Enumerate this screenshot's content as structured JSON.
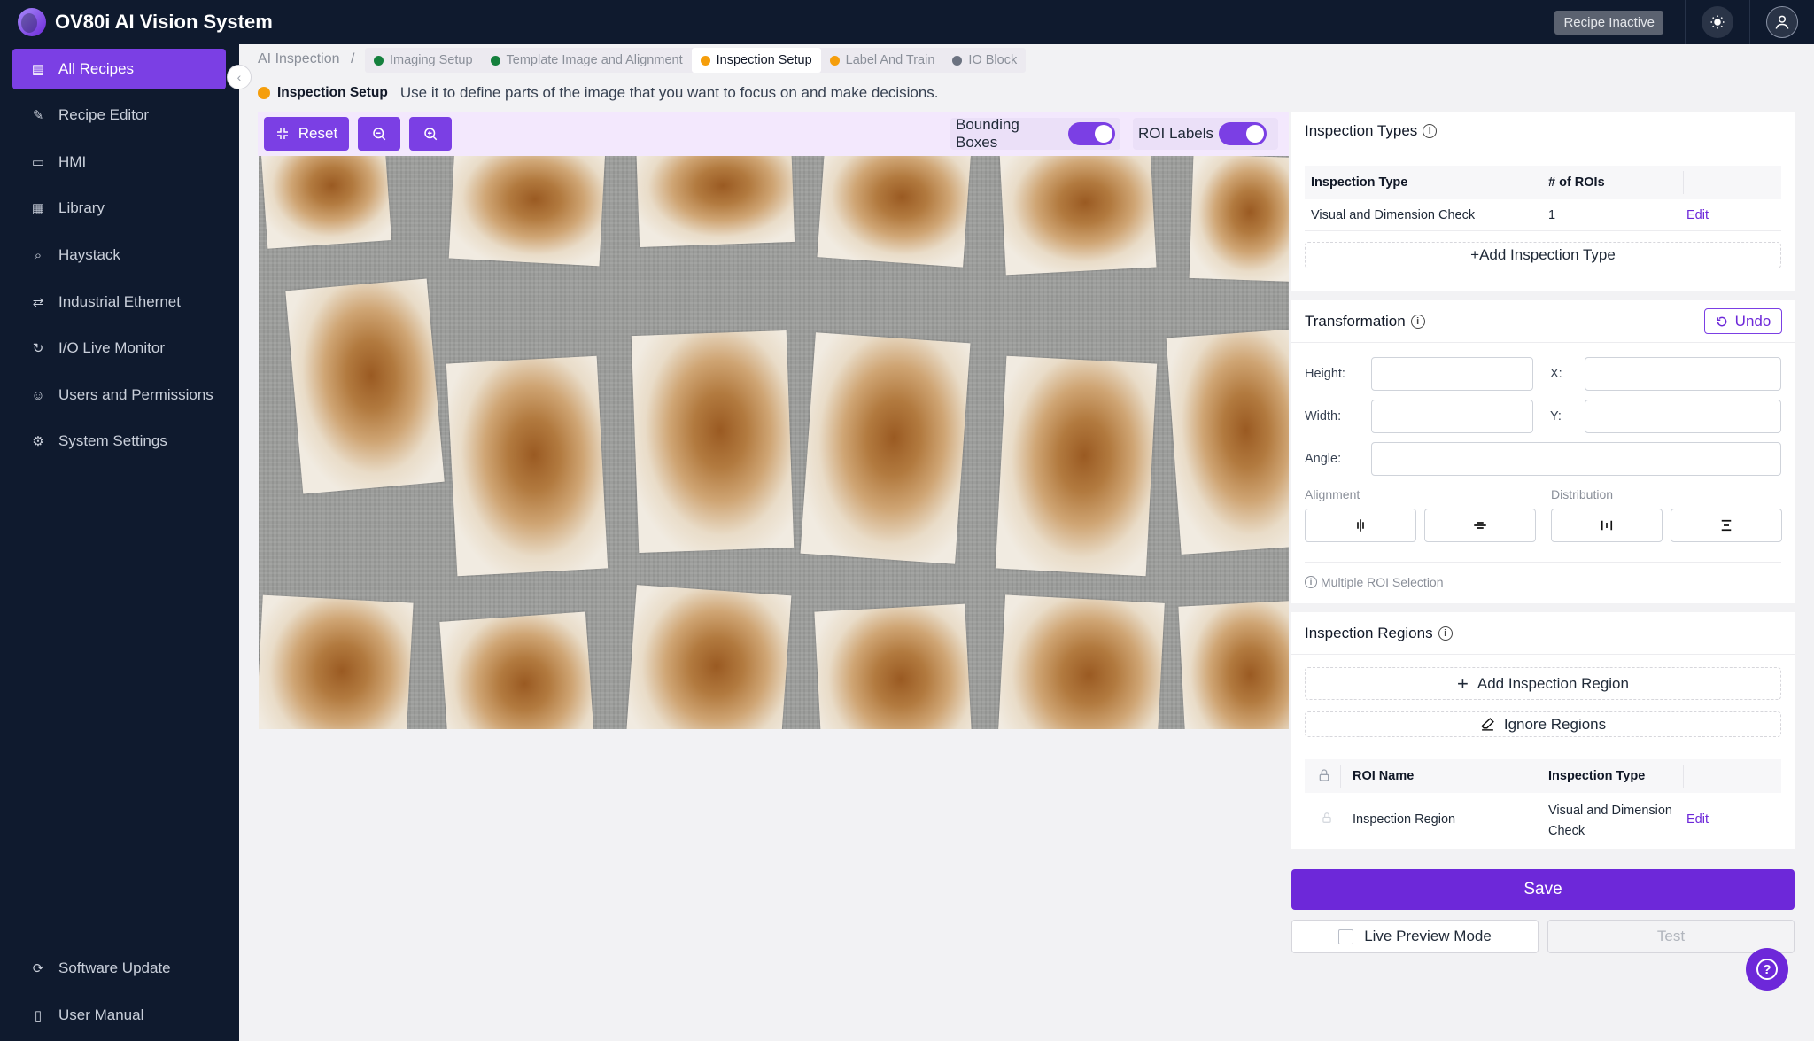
{
  "app": {
    "title": "OV80i AI Vision System",
    "status_badge": "Recipe Inactive",
    "theme_icon": "sun-icon",
    "user_icon": "user-icon"
  },
  "sidebar": {
    "items": [
      {
        "label": "All Recipes",
        "icon": "recipes-icon",
        "active": true
      },
      {
        "label": "Recipe Editor",
        "icon": "pencil-icon"
      },
      {
        "label": "HMI",
        "icon": "video-icon"
      },
      {
        "label": "Library",
        "icon": "grid-icon"
      },
      {
        "label": "Haystack",
        "icon": "search-icon"
      },
      {
        "label": "Industrial Ethernet",
        "icon": "ethernet-icon"
      },
      {
        "label": "I/O Live Monitor",
        "icon": "monitor-icon"
      },
      {
        "label": "Users and Permissions",
        "icon": "user-icon"
      },
      {
        "label": "System Settings",
        "icon": "gear-icon"
      }
    ],
    "bottom": [
      {
        "label": "Software Update",
        "icon": "refresh-icon"
      },
      {
        "label": "User Manual",
        "icon": "book-icon"
      }
    ]
  },
  "breadcrumb": {
    "root": "AI Inspection",
    "separator": "/",
    "tabs": [
      {
        "label": "Imaging Setup",
        "status_color": "#15803d"
      },
      {
        "label": "Template Image and Alignment",
        "status_color": "#15803d"
      },
      {
        "label": "Inspection Setup",
        "status_color": "#f59e0b",
        "active": true
      },
      {
        "label": "Label And Train",
        "status_color": "#f59e0b"
      },
      {
        "label": "IO Block",
        "status_color": "#6b7280"
      }
    ]
  },
  "stage": {
    "title": "Inspection Setup",
    "description": "Use it to define parts of the image that you want to focus on and make decisions.",
    "status_color": "#f59e0b"
  },
  "toolbar": {
    "reset_label": "Reset",
    "zoom_out_icon": "zoom-out-icon",
    "zoom_in_icon": "zoom-in-icon",
    "bounding_boxes_label": "Bounding Boxes",
    "bounding_boxes_on": true,
    "roi_labels_label": "ROI Labels",
    "roi_labels_on": true
  },
  "inspection_types": {
    "title": "Inspection Types",
    "columns": [
      "Inspection Type",
      "# of ROIs"
    ],
    "rows": [
      {
        "type": "Visual and Dimension Check",
        "rois": "1",
        "action": "Edit"
      }
    ],
    "add_label": "+Add Inspection Type"
  },
  "transformation": {
    "title": "Transformation",
    "undo_label": "Undo",
    "height_label": "Height:",
    "width_label": "Width:",
    "angle_label": "Angle:",
    "x_label": "X:",
    "y_label": "Y:",
    "height_value": "",
    "width_value": "",
    "angle_value": "",
    "x_value": "",
    "y_value": "",
    "alignment_label": "Alignment",
    "distribution_label": "Distribution",
    "multi_note": "Multiple ROI Selection"
  },
  "inspection_regions": {
    "title": "Inspection Regions",
    "add_label": "Add Inspection Region",
    "ignore_label": "Ignore Regions",
    "columns": [
      "ROI Name",
      "Inspection Type"
    ],
    "rows": [
      {
        "name": "Inspection Region",
        "type": "Visual and Dimension Check",
        "action": "Edit"
      }
    ]
  },
  "actions": {
    "save_label": "Save",
    "live_preview_label": "Live Preview Mode",
    "live_preview_checked": false,
    "test_label": "Test"
  }
}
